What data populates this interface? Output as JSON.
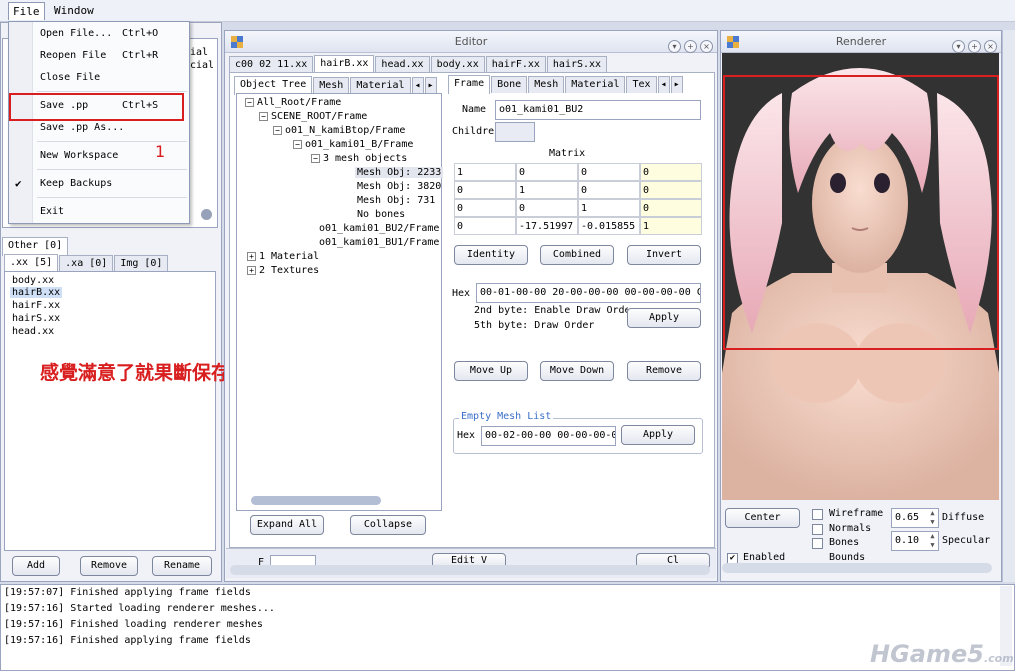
{
  "menubar": {
    "file": "File",
    "window": "Window"
  },
  "file_menu": {
    "items": [
      {
        "label": "Open File...",
        "shortcut": "Ctrl+O"
      },
      {
        "label": "Reopen File",
        "shortcut": "Ctrl+R"
      },
      {
        "label": "Close File",
        "shortcut": ""
      },
      {
        "label": "Save .pp",
        "shortcut": "Ctrl+S"
      },
      {
        "label": "Save .pp As...",
        "shortcut": ""
      },
      {
        "label": "New Workspace",
        "shortcut": ""
      },
      {
        "label": "Keep Backups",
        "shortcut": ""
      },
      {
        "label": "Exit",
        "shortcut": ""
      }
    ],
    "annotation_number": "1"
  },
  "left_panel": {
    "behind_text_1": "ial",
    "behind_text_2": "cial",
    "other_tab": "Other [0]",
    "tabs": [
      ".xx [5]",
      ".xa [0]",
      "Img [0]"
    ],
    "files": [
      "body.xx",
      "hairB.xx",
      "hairF.xx",
      "hairS.xx",
      "head.xx"
    ],
    "buttons": {
      "add": "Add",
      "remove": "Remove",
      "rename": "Rename"
    }
  },
  "annotation_text": "感覺滿意了就果斷保存",
  "editor": {
    "title": "Editor",
    "file_tabs": [
      "c00 02 11.xx",
      "hairB.xx",
      "head.xx",
      "body.xx",
      "hairF.xx",
      "hairS.xx"
    ],
    "left_tabs": [
      "Object Tree",
      "Mesh",
      "Material"
    ],
    "tree": [
      "All_Root/Frame",
      "SCENE_ROOT/Frame",
      "o01_N_kamiBtop/Frame",
      "o01_kami01_B/Frame",
      "3 mesh objects",
      "Mesh Obj: 2233",
      "Mesh Obj: 3820",
      "Mesh Obj: 731",
      "No bones",
      "o01_kami01_BU2/Frame",
      "o01_kami01_BU1/Frame",
      "1 Material",
      "2 Textures"
    ],
    "expand_all": "Expand All",
    "collapse": "Collapse",
    "right_tabs": [
      "Frame",
      "Bone",
      "Mesh",
      "Material",
      "Tex"
    ],
    "name_label": "Name",
    "name_value": "o01_kami01_BU2",
    "children_label": "Children",
    "matrix_label": "Matrix",
    "matrix": [
      [
        "1",
        "0",
        "0",
        "0"
      ],
      [
        "0",
        "1",
        "0",
        "0"
      ],
      [
        "0",
        "0",
        "1",
        "0"
      ],
      [
        "0",
        "-17.51997",
        "-0.015855",
        "1"
      ]
    ],
    "identity": "Identity",
    "combined": "Combined",
    "invert": "Invert",
    "hex_label": "Hex",
    "hex_value": "00-01-00-00 20-00-00-00 00-00-00-00 C",
    "hint1": "2nd byte: Enable Draw Orde",
    "hint2": "5th byte: Draw Order",
    "apply": "Apply",
    "move_up": "Move Up",
    "move_down": "Move Down",
    "remove": "Remove",
    "empty_mesh_list": "Empty Mesh List",
    "hex2_label": "Hex",
    "hex2_value": "00-02-00-00 00-00-00-0",
    "apply2": "Apply",
    "bottom_partial_left": "F",
    "bottom_partial_mid": "Edit V",
    "bottom_partial_right": "Cl"
  },
  "renderer": {
    "title": "Renderer",
    "center": "Center",
    "checks": [
      "Wireframe",
      "Normals",
      "Bones",
      "Bounds"
    ],
    "diffuse_value": "0.65",
    "diffuse_label": "Diffuse",
    "specular_value": "0.10",
    "specular_label": "Specular",
    "enabled": "Enabled"
  },
  "log": [
    "[19:57:07] Finished applying frame fields",
    "[19:57:16] Started loading renderer meshes...",
    "[19:57:16] Finished loading renderer meshes",
    "[19:57:16] Finished applying frame fields"
  ],
  "watermark": "HGame5",
  "watermark_suffix": ".com",
  "colors": {
    "annotation_red": "#d81e1e",
    "selection_blue": "#cfe0f6"
  }
}
